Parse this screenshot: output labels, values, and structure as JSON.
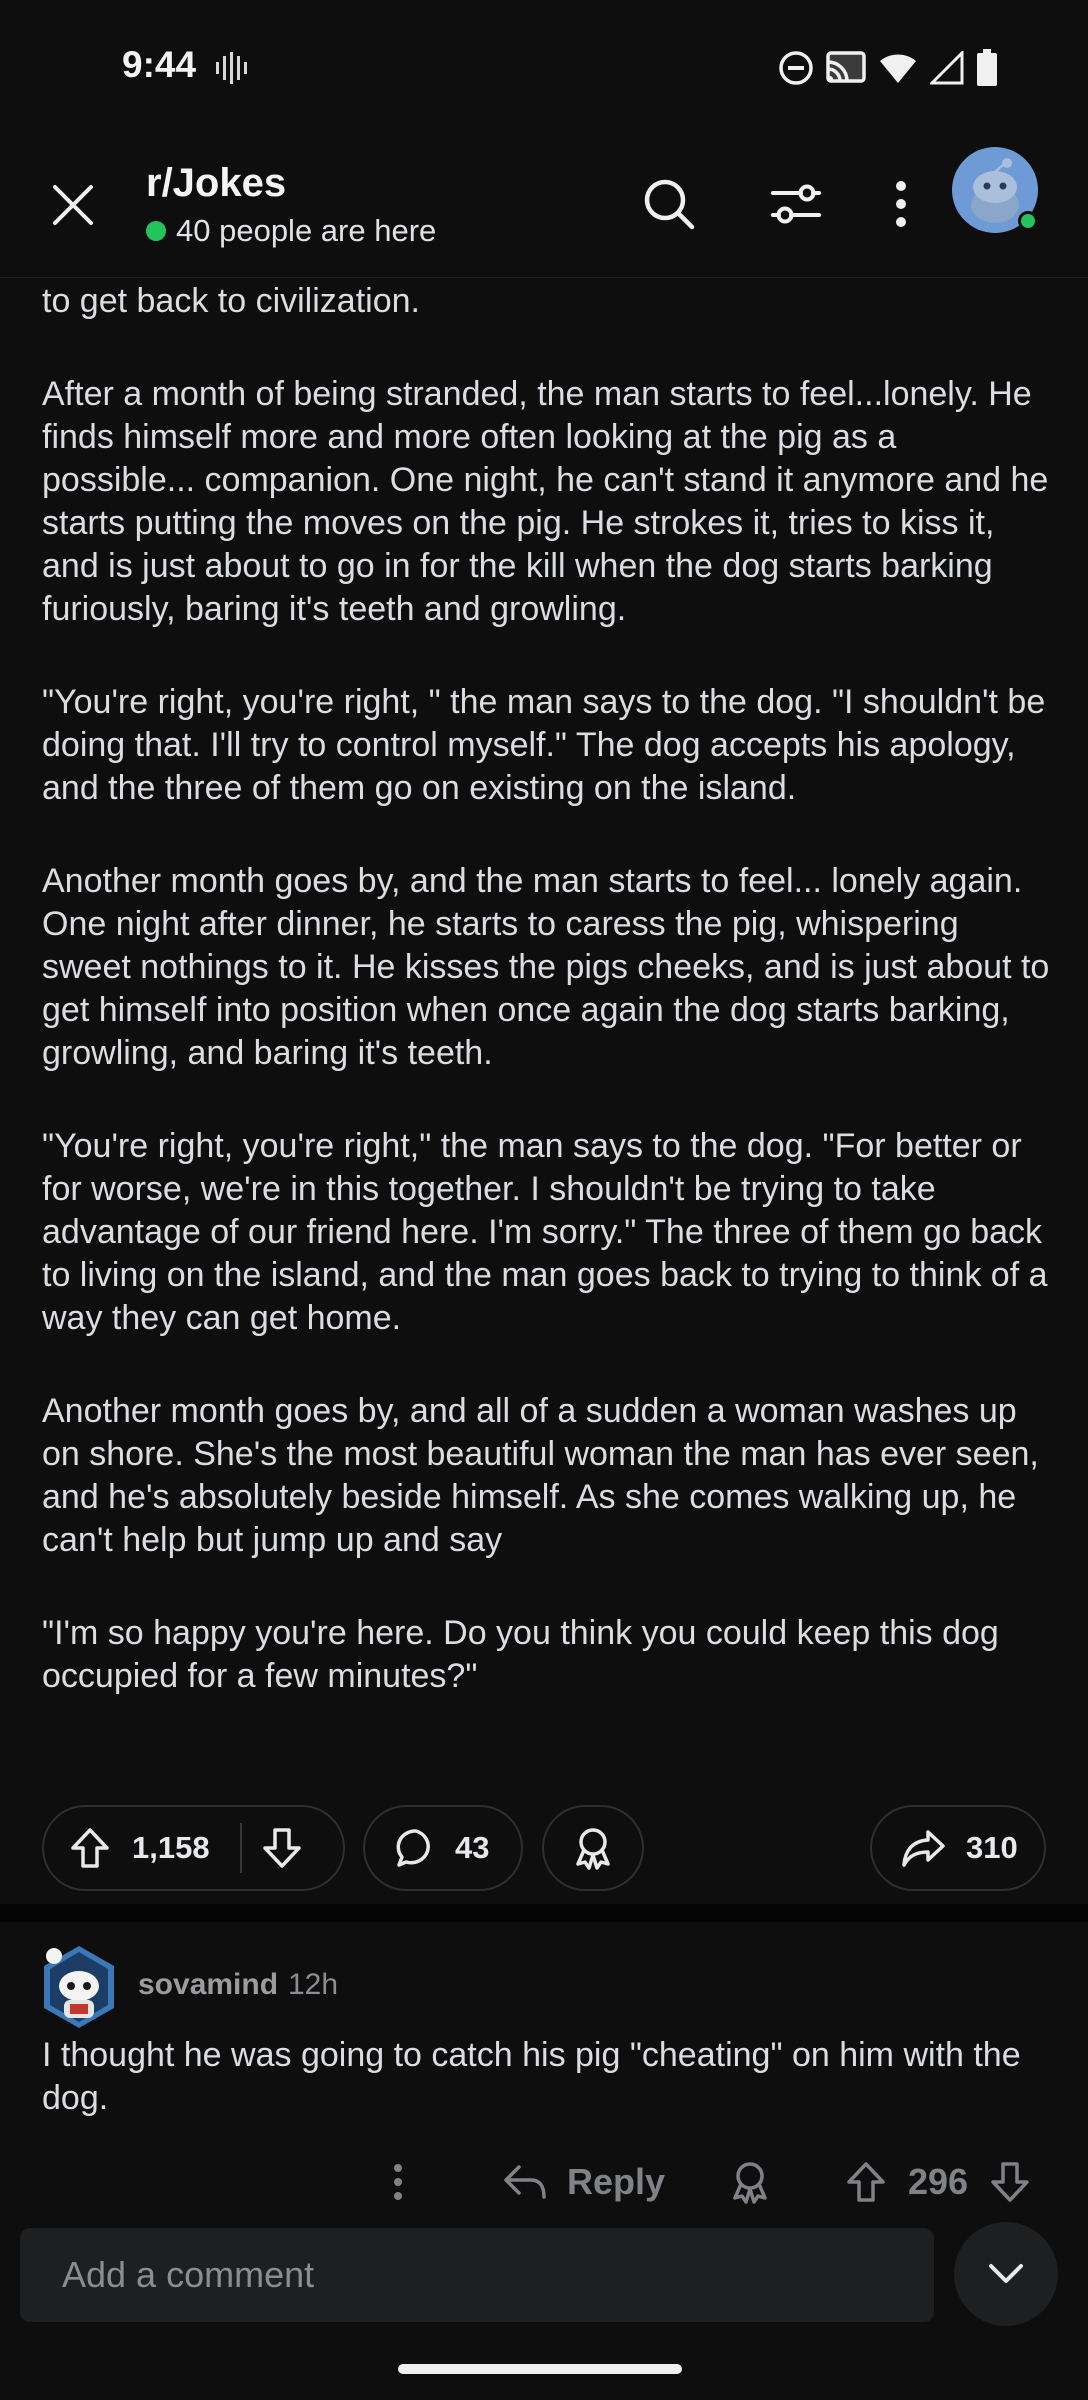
{
  "status_bar": {
    "time": "9:44"
  },
  "header": {
    "subreddit": "r/Jokes",
    "online": "40 people are here",
    "icons": [
      "close-icon",
      "search-icon",
      "filter-icon",
      "more-vertical-icon",
      "avatar"
    ]
  },
  "post": {
    "paragraphs": [
      "to get back to civilization.",
      "After a month of being stranded, the man starts to feel...lonely. He finds himself more and more often looking at the pig as a possible... companion. One night, he can't stand it anymore and he starts putting the moves on the pig. He strokes it, tries to kiss it, and is just about to go in for the kill when the dog starts barking furiously, baring it's teeth and growling.",
      "\"You're right, you're right, \" the man says to the dog. \"I shouldn't be doing that. I'll try to control myself.\" The dog accepts his apology, and the three of them go on existing on the island.",
      "Another month goes by, and the man starts to feel... lonely again. One night after dinner, he starts to caress the pig, whispering sweet nothings to it. He kisses the pigs cheeks, and is just about to get himself into position when once again the dog starts barking, growling, and baring it's teeth.",
      "\"You're right, you're right,\" the man says to the dog. \"For better or for worse, we're in this together. I shouldn't be trying to take advantage of our friend here. I'm sorry.\" The three of them go back to living on the island, and the man goes back to trying to think of a way they can get home.",
      "Another month goes by, and all of a sudden a woman washes up on shore. She's the most beautiful woman the man has ever seen, and he's absolutely beside himself. As she comes walking up, he can't help but jump up and say",
      "\"I'm so happy you're here. Do you think you could keep this dog occupied for a few minutes?\""
    ],
    "upvotes": "1,158",
    "comments": "43",
    "shares": "310"
  },
  "comment": {
    "username": "sovamind",
    "time": "12h",
    "text": "I thought he was going to catch his pig \"cheating\" on him with the dog.",
    "reply_label": "Reply",
    "score": "296"
  },
  "composer": {
    "placeholder": "Add a comment"
  },
  "colors": {
    "background": "#0e0e0f",
    "online_green": "#23c45e",
    "pill_border": "#2e2f33",
    "muted_text": "#808286"
  }
}
